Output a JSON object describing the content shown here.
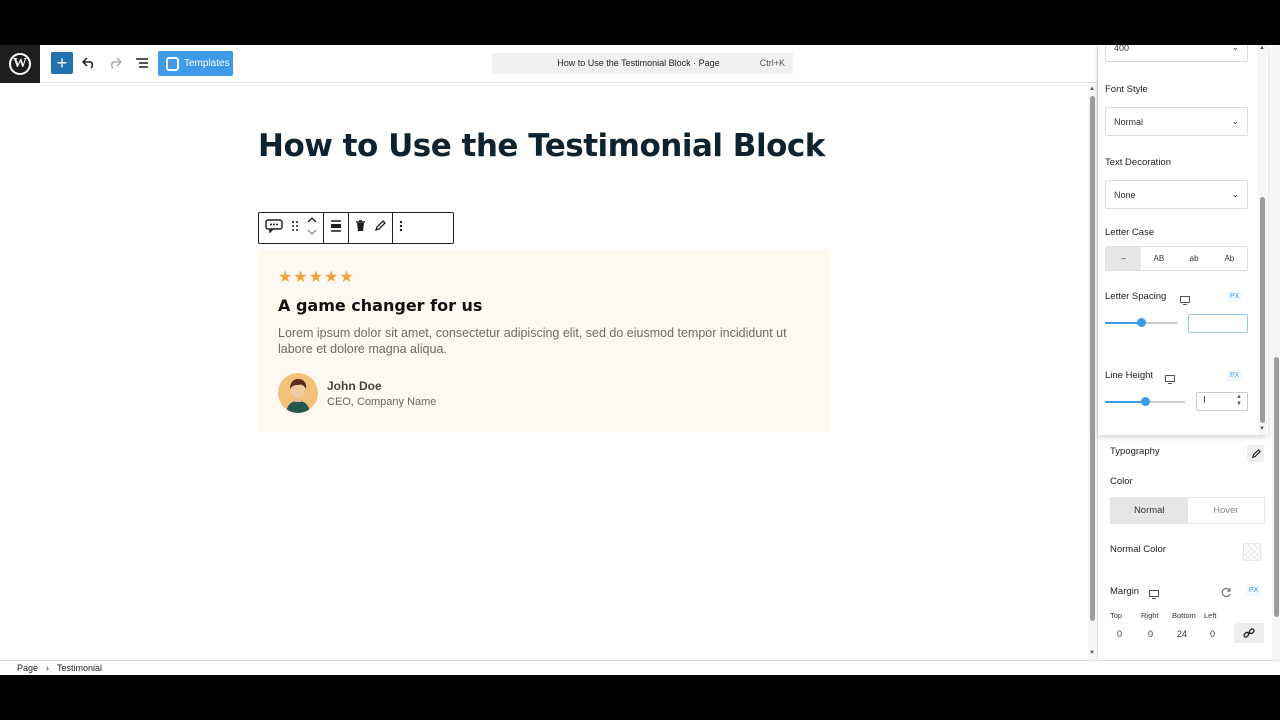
{
  "toolbar": {
    "templates_label": "Templates",
    "command_title": "How to Use the Testimonial Block · Page",
    "command_shortcut": "Ctrl+K"
  },
  "page": {
    "title": "How to Use the Testimonial Block"
  },
  "testimonial": {
    "stars": 5,
    "heading": "A game changer for us",
    "body": "Lorem ipsum dolor sit amet, consectetur adipiscing elit, sed do eiusmod tempor incididunt ut labore et dolore magna aliqua.",
    "author_name": "John Doe",
    "author_role": "CEO, Company Name",
    "star_color": "#f2a23a"
  },
  "breadcrumb": {
    "items": [
      "Page",
      "Testimonial"
    ]
  },
  "sidebar": {
    "font_weight_value": "400",
    "font_style_label": "Font Style",
    "font_style_value": "Normal",
    "text_decoration_label": "Text Decoration",
    "text_decoration_value": "None",
    "letter_case_label": "Letter Case",
    "letter_case_options": [
      "–",
      "AB",
      "ab",
      "Ab"
    ],
    "letter_spacing_label": "Letter Spacing",
    "line_height_label": "Line Height",
    "unit": "PX",
    "letter_spacing_slider": 0.5,
    "line_height_slider": 0.5,
    "typography_label": "Typography",
    "color_label": "Color",
    "color_tabs": [
      "Normal",
      "Hover"
    ],
    "normal_color_label": "Normal Color",
    "margin_label": "Margin",
    "margin_sides": [
      "Top",
      "Right",
      "Bottom",
      "Left"
    ],
    "margin_values": [
      "0",
      "0",
      "24",
      "0"
    ]
  },
  "colors": {
    "accent": "#3c9ae8",
    "wp_blue": "#2271b1"
  }
}
